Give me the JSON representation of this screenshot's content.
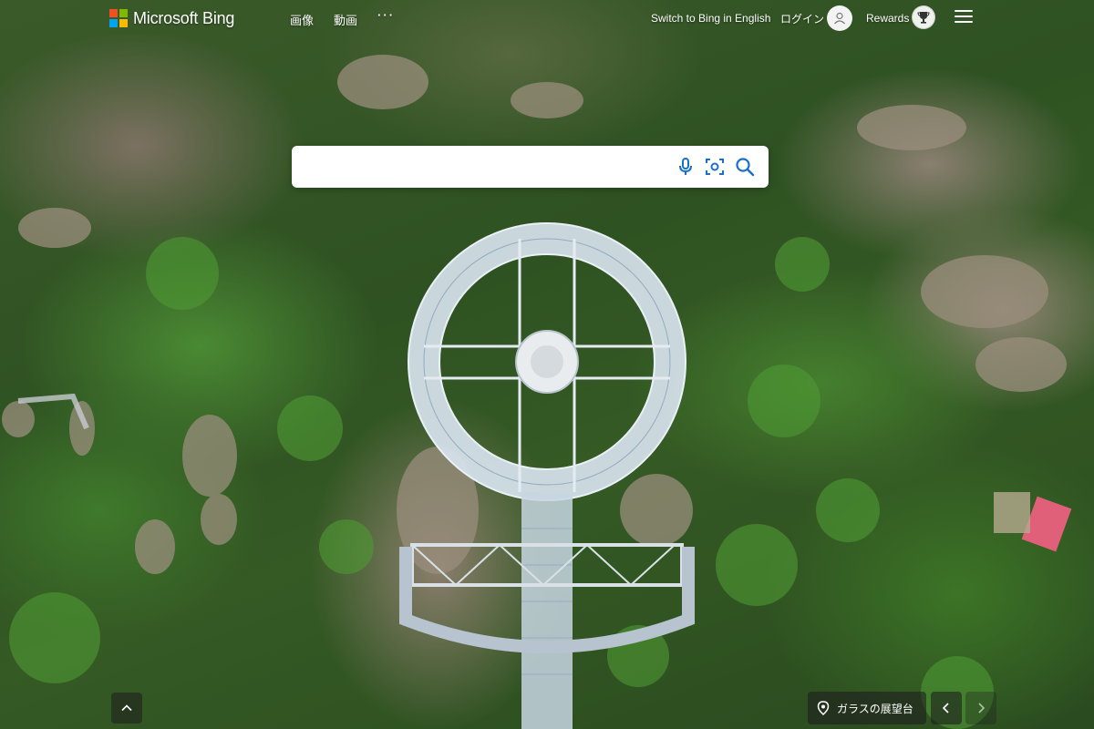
{
  "brand": {
    "name": "Microsoft Bing",
    "square_colors": [
      "#f25022",
      "#7fba00",
      "#00a4ef",
      "#ffb900"
    ]
  },
  "nav": {
    "items": [
      {
        "label": "画像"
      },
      {
        "label": "動画"
      }
    ],
    "more_label": "···"
  },
  "header_right": {
    "switch_language": "Switch to Bing in English",
    "login": "ログイン",
    "rewards": "Rewards"
  },
  "search": {
    "value": "",
    "placeholder": "",
    "icons": [
      "microphone-icon",
      "visual-search-icon",
      "search-icon"
    ]
  },
  "image_info": {
    "title": "ガラスの展望台"
  },
  "colors": {
    "accent": "#0078d4",
    "overlay": "#1e1e1e"
  }
}
